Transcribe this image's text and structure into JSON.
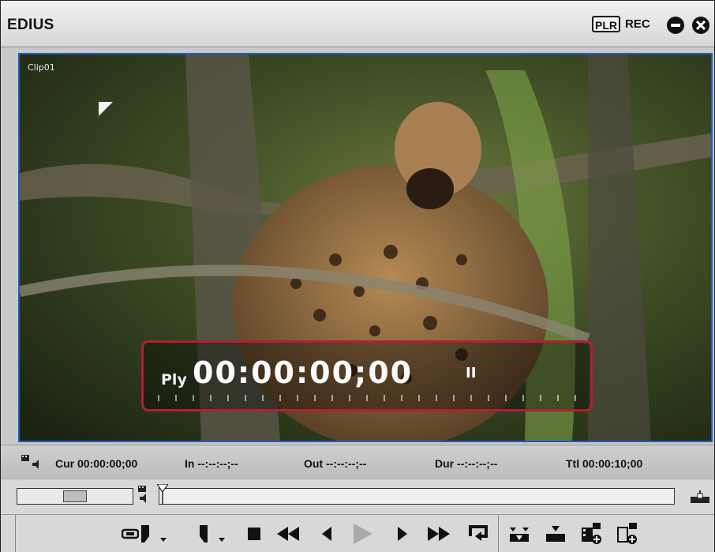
{
  "app": {
    "title": "EDIUS",
    "plr_label": "PLR",
    "rec_label": "REC"
  },
  "video": {
    "clip_name": "Clip01",
    "overlay": {
      "mode_label": "Ply",
      "timecode": "00:00:00;00",
      "pause_glyph": "II"
    }
  },
  "info_bar": {
    "cur": "Cur 00:00:00;00",
    "in": "In --:--:--;--",
    "out": "Out --:--:--;--",
    "dur": "Dur --:--:--;--",
    "ttl": "Ttl 00:00:10;00"
  },
  "scrubber": {
    "position_fraction": 0.0,
    "shuttle_position_fraction": 0.5
  },
  "controls": [
    "set-in-marker-icon",
    "set-in-icon",
    "set-out-icon",
    "stop-icon",
    "rewind-icon",
    "step-back-icon",
    "play-icon",
    "step-forward-icon",
    "fast-forward-icon",
    "loop-icon",
    "insert-to-timeline-icon",
    "overwrite-to-timeline-icon",
    "add-to-bin-icon",
    "add-to-bin-alt-icon"
  ],
  "colors": {
    "video_border": "#1f5bbd",
    "highlight_border": "#b21f34",
    "background": "#c9c9c9"
  }
}
